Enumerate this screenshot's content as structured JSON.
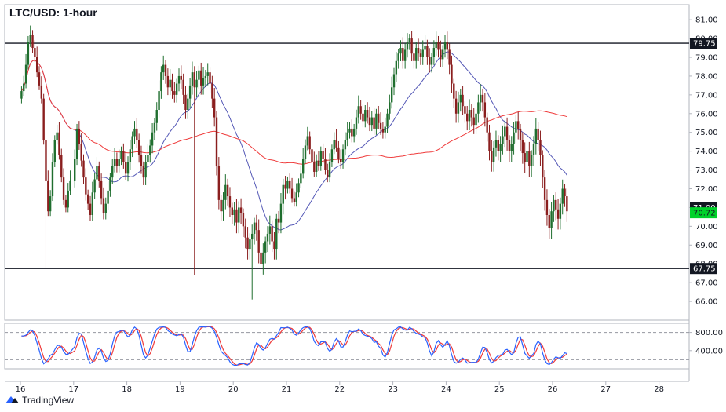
{
  "chart_data": {
    "type": "candlestick",
    "title": "LTC/USD: 1-hour",
    "watermark": "TradingView",
    "x_ticks": [
      "16",
      "17",
      "18",
      "19",
      "20",
      "21",
      "22",
      "23",
      "24",
      "25",
      "26",
      "27",
      "28"
    ],
    "price_ticks": [
      81.0,
      80.0,
      79.0,
      78.0,
      77.0,
      76.0,
      75.0,
      74.0,
      73.0,
      72.0,
      71.0,
      70.0,
      69.0,
      68.0,
      67.0,
      66.0
    ],
    "price_ylim": [
      65.0,
      81.8
    ],
    "horizontal_levels": [
      {
        "value": 79.75,
        "label": "79.75"
      },
      {
        "value": 67.75,
        "label": "67.75"
      }
    ],
    "price_labels": [
      {
        "value": 71.0,
        "label": "71.00",
        "bg": "#131722",
        "fg": "#ffffff"
      },
      {
        "value": 70.72,
        "label": "70.72",
        "bg": "#00d12a",
        "fg": "#131722"
      }
    ],
    "ma_fast_color": "#5458b6",
    "ma_slow_color": "#ef3b3b",
    "candle_up_color": "#1f6e2e",
    "candle_down_color": "#8a1e1e",
    "stoch_ticks": [
      {
        "value": 80,
        "label": "800.00"
      },
      {
        "value": 40,
        "label": "400.00"
      }
    ],
    "stoch_ylim": [
      0,
      100
    ],
    "stoch_levels": [
      80,
      20
    ],
    "stoch_k_color": "#2962ff",
    "stoch_d_color": "#ef3b3b",
    "days": [
      {
        "label": "16",
        "closes": [
          77.2,
          77.6,
          78.6,
          79.8,
          80.2,
          79.5,
          79.0,
          78.2,
          77.5,
          76.8,
          74.6,
          72.4,
          70.8,
          71.6,
          73.4,
          74.6,
          75.0,
          73.8,
          72.6,
          71.4,
          71.0,
          71.9,
          72.4
        ]
      },
      {
        "label": "17",
        "closes": [
          73.6,
          75.2,
          74.4,
          73.5,
          72.6,
          71.7,
          71.2,
          70.6,
          71.8,
          72.5,
          73.2,
          72.4,
          71.5,
          70.7,
          71.2,
          71.9,
          72.6,
          73.2,
          73.6,
          73.2,
          73.6,
          74.0,
          73.4,
          72.8
        ]
      },
      {
        "label": "18",
        "closes": [
          73.4,
          74.1,
          74.8,
          75.2,
          74.6,
          73.8,
          73.2,
          72.6,
          73.4,
          73.8,
          74.3,
          75.0,
          75.5,
          76.2,
          77.2,
          78.2,
          78.6,
          78.0,
          77.4,
          77.8,
          77.2,
          77.0,
          77.6,
          78.0
        ]
      },
      {
        "label": "19",
        "closes": [
          77.8,
          77.0,
          76.2,
          76.8,
          77.5,
          78.2,
          77.4,
          77.8,
          78.3,
          77.5,
          77.9,
          78.0,
          78.2,
          77.6,
          76.8,
          75.8,
          73.2,
          71.4,
          70.8,
          71.4,
          72.2,
          71.6,
          71.0,
          70.6
        ]
      },
      {
        "label": "20",
        "closes": [
          70.9,
          70.2,
          71.0,
          70.7,
          70.0,
          69.4,
          68.8,
          69.3,
          69.6,
          70.2,
          69.8,
          68.6,
          68.0,
          68.6,
          69.2,
          69.6,
          70.0,
          69.2,
          68.8,
          70.4,
          70.2,
          71.2,
          72.2,
          72.0
        ]
      },
      {
        "label": "21",
        "closes": [
          72.4,
          72.0,
          71.5,
          71.3,
          71.8,
          72.3,
          72.8,
          73.6,
          74.3,
          74.8,
          74.1,
          73.4,
          72.9,
          73.5,
          73.2,
          74.0,
          73.6,
          73.0,
          72.6,
          73.4,
          74.1,
          74.6,
          74.2,
          73.6
        ]
      },
      {
        "label": "22",
        "closes": [
          73.4,
          74.1,
          74.6,
          75.0,
          75.2,
          74.8,
          75.2,
          75.8,
          76.4,
          76.0,
          75.6,
          76.2,
          75.8,
          75.4,
          75.8,
          75.2,
          76.0,
          75.5,
          75.2,
          75.0,
          75.3,
          76.0,
          76.6,
          77.4
        ]
      },
      {
        "label": "23",
        "closes": [
          78.1,
          78.8,
          79.2,
          79.5,
          78.8,
          79.4,
          79.8,
          80.0,
          79.2,
          78.8,
          79.5,
          79.2,
          79.0,
          79.4,
          79.6,
          79.0,
          78.6,
          79.0,
          79.5,
          79.8,
          79.4,
          78.9,
          79.4,
          79.8
        ]
      },
      {
        "label": "24",
        "closes": [
          79.4,
          78.6,
          77.6,
          76.8,
          76.0,
          76.6,
          77.0,
          76.4,
          76.0,
          75.6,
          76.2,
          75.8,
          75.4,
          76.0,
          76.6,
          77.0,
          76.6,
          75.8,
          75.0,
          74.0,
          73.4,
          74.2,
          74.6,
          74.0
        ]
      },
      {
        "label": "25",
        "closes": [
          74.4,
          74.8,
          75.3,
          74.6,
          74.0,
          74.4,
          75.0,
          75.6,
          75.2,
          74.6,
          73.9,
          73.4,
          74.0,
          73.2,
          73.8,
          74.4,
          75.2,
          74.6,
          73.8,
          72.6,
          71.4,
          70.6,
          69.9,
          70.8,
          71.4,
          70.9,
          70.4,
          71.2,
          72.0,
          71.6,
          70.8
        ]
      }
    ]
  }
}
